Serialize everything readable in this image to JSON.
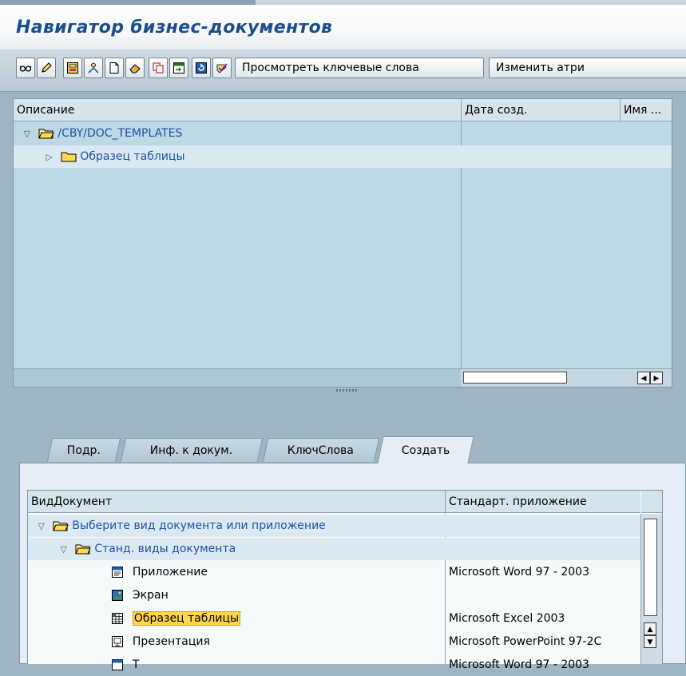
{
  "window": {
    "title": "Навигатор бизнес-документов"
  },
  "toolbar": {
    "icons": [
      "glasses-icon",
      "pencil-icon",
      "layout-icon",
      "user-tree-icon",
      "new-doc-icon",
      "eraser-icon",
      "copy-icon",
      "import-icon",
      "refresh-icon",
      "check-icon"
    ],
    "buttons": [
      "Просмотреть ключевые слова",
      "Изменить атри"
    ]
  },
  "upper": {
    "columns": [
      "Описание",
      "Дата созд.",
      "Имя ..."
    ],
    "rows": [
      {
        "label": "/CBY/DOC_TEMPLATES",
        "expander": "▽"
      },
      {
        "label": "Образец таблицы",
        "expander": "▷"
      }
    ]
  },
  "tabs": [
    "Подр.",
    "Инф. к докум.",
    "КлючСлова",
    "Создать"
  ],
  "lower": {
    "columns": [
      "ВидДокумент",
      "Стандарт. приложение"
    ],
    "rows": [
      {
        "label": "Выберите вид документа или приложение",
        "app": "",
        "expander": "▽"
      },
      {
        "label": "Станд. виды документа",
        "app": "",
        "expander": "▽"
      },
      {
        "label": "Приложение",
        "app": "Microsoft Word 97 - 2003"
      },
      {
        "label": "Экран",
        "app": ""
      },
      {
        "label": "Образец таблицы",
        "app": "Microsoft Excel 2003"
      },
      {
        "label": "Презентация",
        "app": "Microsoft PowerPoint 97-2С"
      },
      {
        "label": "Т",
        "app": "Microsoft Word 97 - 2003"
      }
    ]
  },
  "colors": {
    "title": "#1b4f8c",
    "tree_link": "#1c53a6",
    "selection": "#ffd54a"
  }
}
